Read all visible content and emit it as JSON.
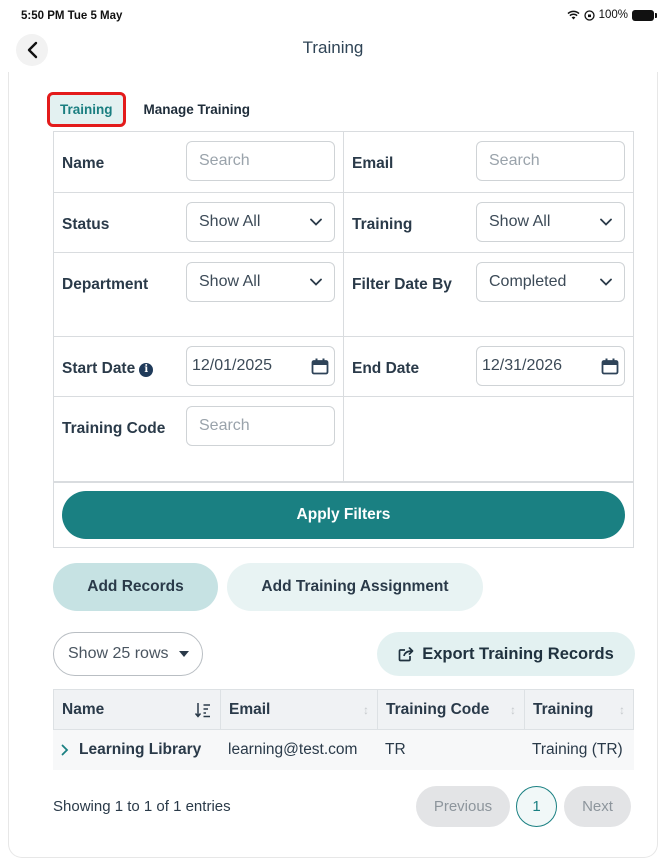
{
  "status_bar": {
    "time": "5:50 PM  Tue 5 May",
    "battery": "100%"
  },
  "nav": {
    "title": "Training"
  },
  "tabs": [
    {
      "label": "Training"
    },
    {
      "label": "Manage Training"
    }
  ],
  "filters": {
    "name": {
      "label": "Name",
      "placeholder": "Search"
    },
    "email": {
      "label": "Email",
      "placeholder": "Search"
    },
    "status": {
      "label": "Status",
      "value": "Show All"
    },
    "training": {
      "label": "Training",
      "value": "Show All"
    },
    "department": {
      "label": "Department",
      "value": "Show All"
    },
    "filter_date_by": {
      "label": "Filter Date By",
      "value": "Completed"
    },
    "start_date": {
      "label": "Start Date",
      "value": "12/01/2025"
    },
    "end_date": {
      "label": "End Date",
      "value": "12/31/2026"
    },
    "training_code": {
      "label": "Training Code",
      "placeholder": "Search"
    },
    "apply_label": "Apply Filters"
  },
  "actions": {
    "add_records": "Add Records",
    "add_assignment": "Add Training Assignment",
    "rows_select": "Show 25 rows",
    "export": "Export Training Records"
  },
  "table": {
    "headers": [
      "Name",
      "Email",
      "Training Code",
      "Training"
    ],
    "rows": [
      {
        "name": "Learning Library",
        "email": "learning@test.com",
        "code": "TR",
        "training": "Training (TR)"
      }
    ]
  },
  "pagination": {
    "summary": "Showing 1 to 1 of 1 entries",
    "previous": "Previous",
    "current_page": "1",
    "next": "Next"
  },
  "colors": {
    "accent": "#1a8082",
    "accent_light": "#e3f1f1",
    "highlight": "#e31b1b"
  }
}
